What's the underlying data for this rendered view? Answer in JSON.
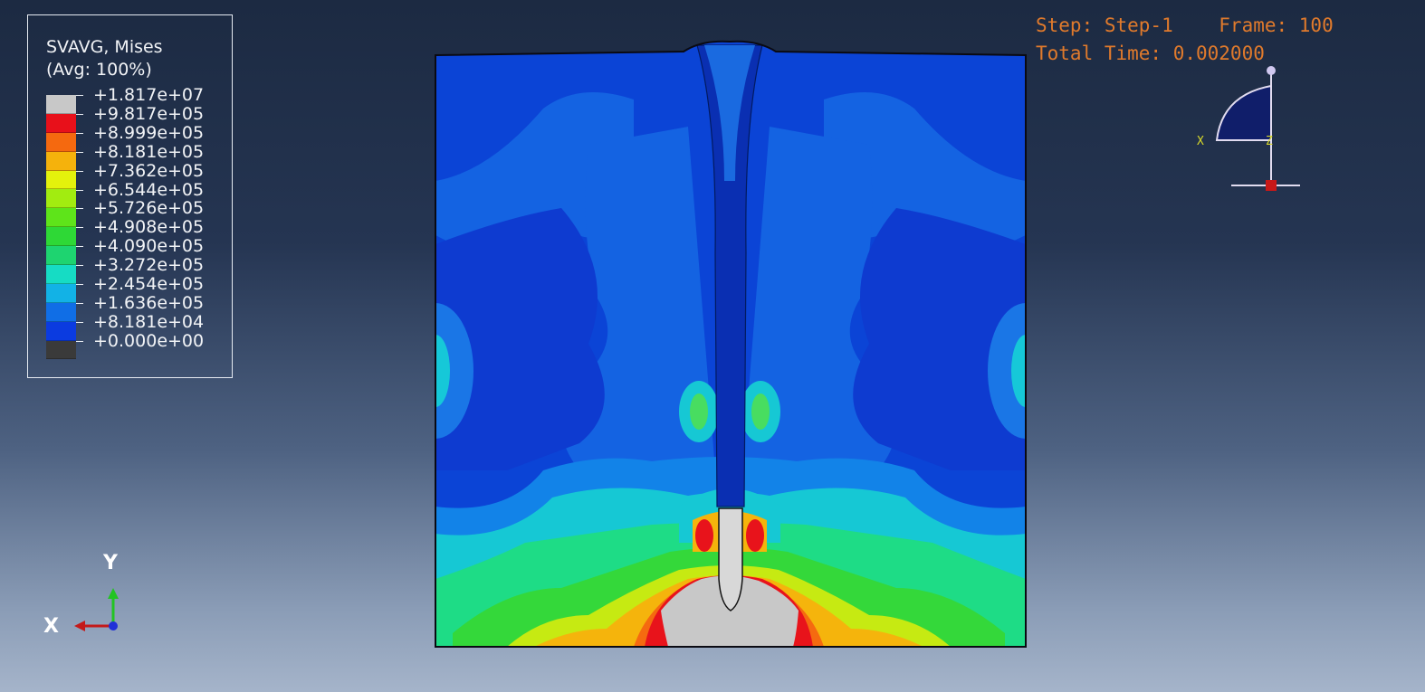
{
  "legend": {
    "title_line1": "SVAVG, Mises",
    "title_line2": "(Avg: 100%)",
    "entries": [
      {
        "label": "+1.817e+07",
        "color": "#c8c8c8"
      },
      {
        "label": "+9.817e+05",
        "color": "#e8101a"
      },
      {
        "label": "+8.999e+05",
        "color": "#f5690f"
      },
      {
        "label": "+8.181e+05",
        "color": "#f5b20c"
      },
      {
        "label": "+7.362e+05",
        "color": "#e4f20c"
      },
      {
        "label": "+6.544e+05",
        "color": "#a2ec10"
      },
      {
        "label": "+5.726e+05",
        "color": "#5ee41a"
      },
      {
        "label": "+4.908e+05",
        "color": "#2ed836"
      },
      {
        "label": "+4.090e+05",
        "color": "#1ed470"
      },
      {
        "label": "+3.272e+05",
        "color": "#16dcc4"
      },
      {
        "label": "+2.454e+05",
        "color": "#12b2e6"
      },
      {
        "label": "+1.636e+05",
        "color": "#106ee6"
      },
      {
        "label": "+8.181e+04",
        "color": "#0b3be0"
      },
      {
        "label": "+0.000e+00",
        "color": "#3a3a3a"
      }
    ]
  },
  "status": {
    "line1": "Step: Step-1    Frame: 100",
    "line2": "Total Time: 0.002000"
  },
  "orientation_triad": {
    "x_label": "X",
    "y_label": "Y"
  },
  "view_cube": {
    "x_label": "X",
    "z_label": "Z"
  },
  "colors": {
    "background_top": "#1c2a42",
    "background_bottom": "#a5b4ca",
    "status_text": "#e07a2c",
    "model_base": "#0b3fd6"
  }
}
